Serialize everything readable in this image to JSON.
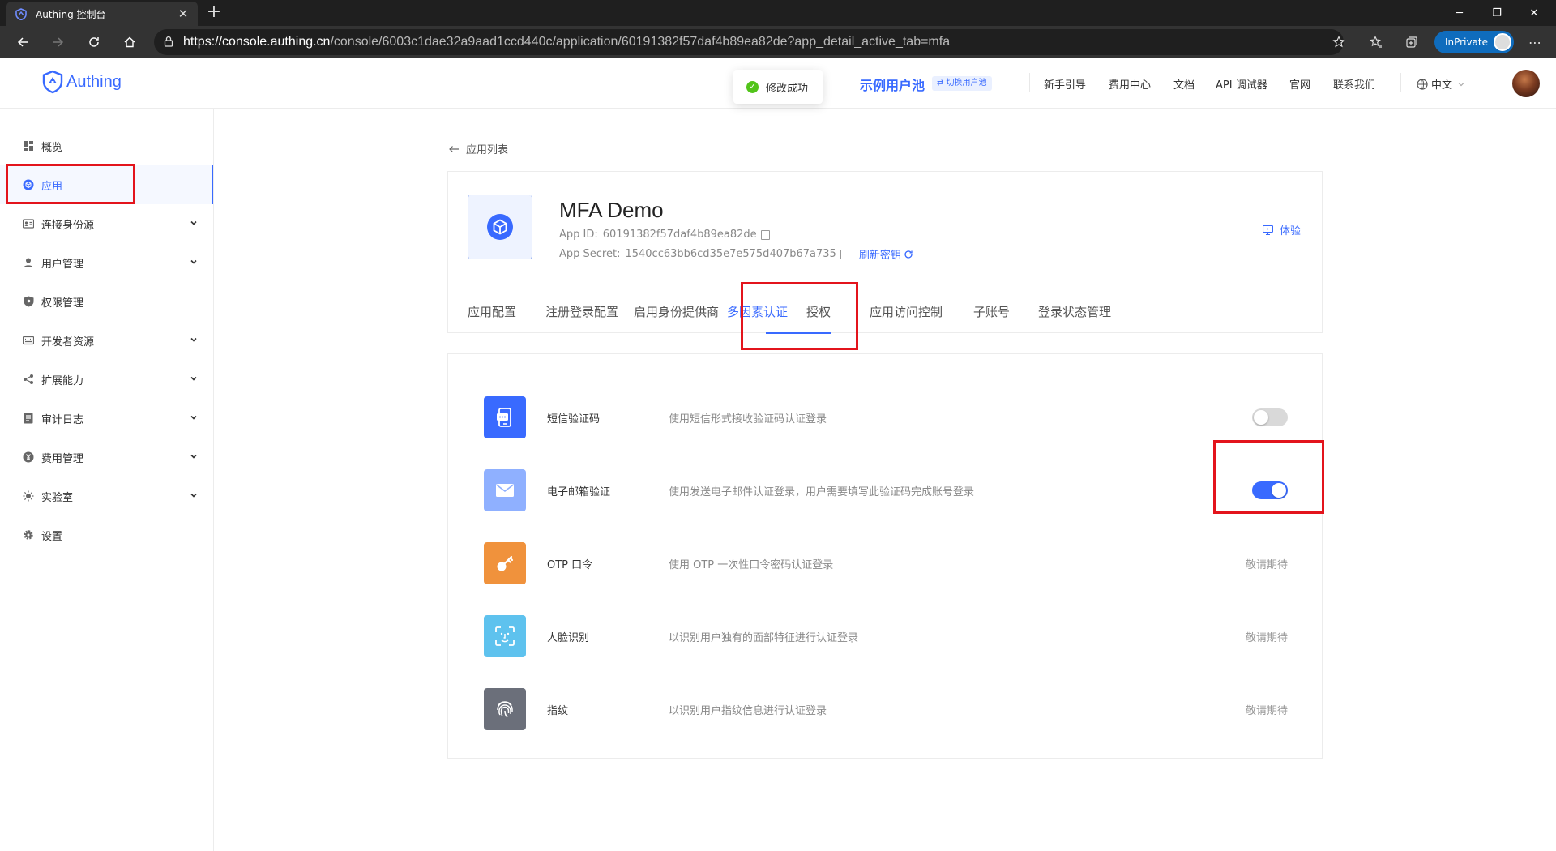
{
  "browser": {
    "tab_title": "Authing 控制台",
    "url_host": "https://console.authing.cn",
    "url_path": "/console/6003c1dae32a9aad1ccd440c/application/60191382f57daf4b89ea82de?app_detail_active_tab=mfa",
    "inprivate_label": "InPrivate"
  },
  "header": {
    "logo_text": "Authing",
    "pool_name": "示例用户池",
    "switch_pool": "⇄ 切换用户池",
    "links": [
      "新手引导",
      "费用中心",
      "文档",
      "API 调试器",
      "官网",
      "联系我们"
    ],
    "language": "中文"
  },
  "toast": {
    "message": "修改成功"
  },
  "sidebar": {
    "items": [
      {
        "label": "概览",
        "icon": "dashboard-icon"
      },
      {
        "label": "应用",
        "icon": "cube-icon"
      },
      {
        "label": "连接身份源",
        "icon": "id-card-icon"
      },
      {
        "label": "用户管理",
        "icon": "user-icon"
      },
      {
        "label": "权限管理",
        "icon": "shield-icon"
      },
      {
        "label": "开发者资源",
        "icon": "keyboard-icon"
      },
      {
        "label": "扩展能力",
        "icon": "share-icon"
      },
      {
        "label": "审计日志",
        "icon": "log-icon"
      },
      {
        "label": "费用管理",
        "icon": "yuan-icon"
      },
      {
        "label": "实验室",
        "icon": "bulb-icon"
      },
      {
        "label": "设置",
        "icon": "gear-icon"
      }
    ]
  },
  "main": {
    "back_label": "应用列表",
    "app": {
      "name": "MFA Demo",
      "app_id_label": "App ID:",
      "app_id": "60191382f57daf4b89ea82de",
      "app_secret_label": "App Secret:",
      "app_secret": "1540cc63bb6cd35e7e575d407b67a735",
      "refresh_label": "刷新密钥",
      "try_label": "体验"
    },
    "tabs": [
      "应用配置",
      "注册登录配置",
      "启用身份提供商",
      "多因素认证",
      "授权",
      "应用访问控制",
      "子账号",
      "登录状态管理"
    ],
    "active_tab": "多因素认证",
    "mfa": [
      {
        "name": "短信验证码",
        "desc": "使用短信形式接收验证码认证登录",
        "icon": "sms-icon",
        "color": "#396aff",
        "status": "off"
      },
      {
        "name": "电子邮箱验证",
        "desc": "使用发送电子邮件认证登录，用户需要填写此验证码完成账号登录",
        "icon": "mail-icon",
        "color": "#8fb0ff",
        "status": "on"
      },
      {
        "name": "OTP 口令",
        "desc": "使用 OTP 一次性口令密码认证登录",
        "icon": "key-icon",
        "color": "#f0923c",
        "status": "敬请期待"
      },
      {
        "name": "人脸识别",
        "desc": "以识别用户独有的面部特征进行认证登录",
        "icon": "face-scan-icon",
        "color": "#5ec2ee",
        "status": "敬请期待"
      },
      {
        "name": "指纹",
        "desc": "以识别用户指纹信息进行认证登录",
        "icon": "fingerprint-icon",
        "color": "#6b6f7a",
        "status": "敬请期待"
      }
    ]
  },
  "colors": {
    "accent": "#396aff",
    "annotation": "#e3141c"
  }
}
